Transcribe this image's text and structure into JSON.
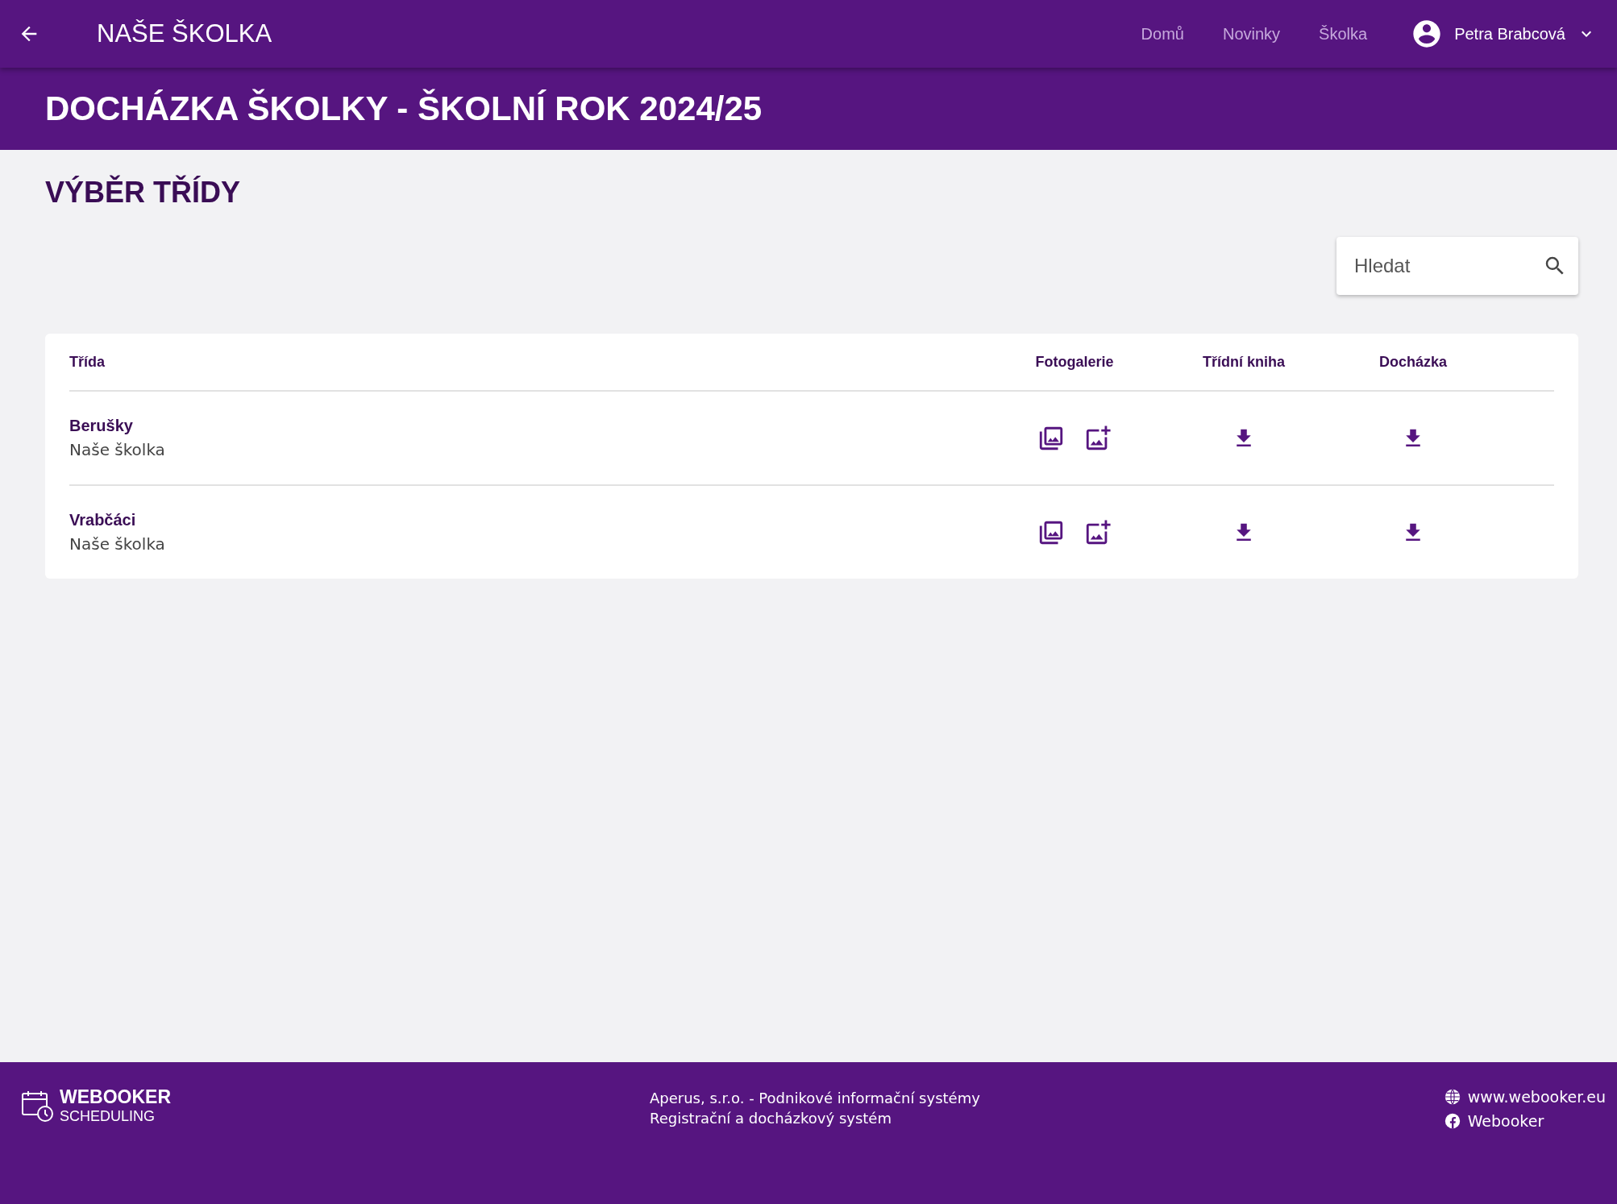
{
  "app_bar": {
    "title": "NAŠE ŠKOLKA",
    "nav": [
      "Domů",
      "Novinky",
      "Školka"
    ],
    "user": "Petra Brabcová"
  },
  "page_title": "DOCHÁZKA ŠKOLKY - ŠKOLNÍ ROK 2024/25",
  "section_title": "VÝBĚR TŘÍDY",
  "search": {
    "placeholder": "Hledat"
  },
  "table": {
    "columns": [
      "Třída",
      "Fotogalerie",
      "Třídní kniha",
      "Docházka"
    ],
    "rows": [
      {
        "name": "Berušky",
        "school": "Naše školka"
      },
      {
        "name": "Vrabčáci",
        "school": "Naše školka"
      }
    ]
  },
  "footer": {
    "brand": "WEBOOKER",
    "brand_sub": "SCHEDULING",
    "lines": [
      "Aperus, s.r.o. - Podnikové informační systémy",
      "Registrační a docházkový systém"
    ],
    "links": [
      {
        "kind": "web",
        "label": "www.webooker.eu"
      },
      {
        "kind": "facebook",
        "label": "Webooker"
      }
    ]
  }
}
